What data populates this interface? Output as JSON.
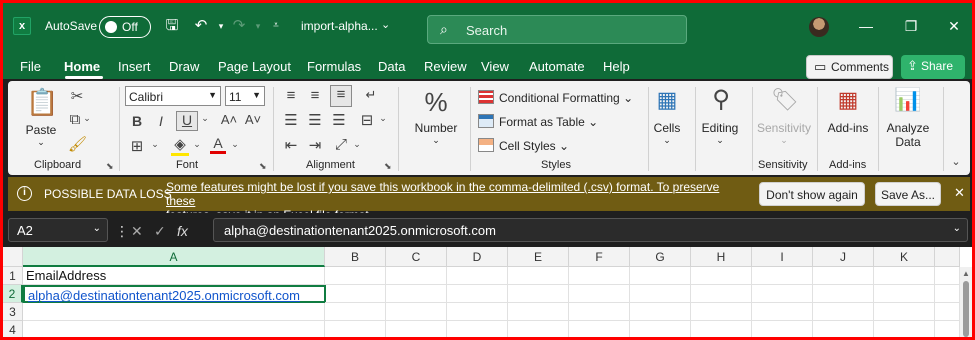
{
  "titlebar": {
    "autosave_label": "AutoSave",
    "autosave_state": "Off",
    "file_name": "import-alpha...",
    "search_placeholder": "Search"
  },
  "menu": [
    "File",
    "Home",
    "Insert",
    "Draw",
    "Page Layout",
    "Formulas",
    "Data",
    "Review",
    "View",
    "Automate",
    "Help"
  ],
  "active_menu": "Home",
  "comments_label": "Comments",
  "share_label": "Share",
  "ribbon": {
    "clipboard": {
      "paste": "Paste",
      "label": "Clipboard"
    },
    "font": {
      "name": "Calibri",
      "size": "11",
      "label": "Font"
    },
    "alignment": {
      "label": "Alignment"
    },
    "number": {
      "label": "Number"
    },
    "styles": {
      "conditional": "Conditional Formatting",
      "format_table": "Format as Table",
      "cell_styles": "Cell Styles",
      "label": "Styles"
    },
    "cells": {
      "label": "Cells"
    },
    "editing": {
      "label": "Editing"
    },
    "sensitivity": {
      "button": "Sensitivity",
      "label": "Sensitivity"
    },
    "addins": {
      "button": "Add-ins",
      "label": "Add-ins"
    },
    "analyze": {
      "line1": "Analyze",
      "line2": "Data"
    }
  },
  "message_bar": {
    "title": "POSSIBLE DATA LOSS",
    "line1": "Some features might be lost if you save this workbook in the comma-delimited (.csv) format. To preserve these",
    "line2": "features, save it in an Excel file format.",
    "dont_show": "Don't show again",
    "save_as": "Save As..."
  },
  "formula_bar": {
    "name_box": "A2",
    "formula": "alpha@destinationtenant2025.onmicrosoft.com"
  },
  "sheet": {
    "columns": [
      "A",
      "B",
      "C",
      "D",
      "E",
      "F",
      "G",
      "H",
      "I",
      "J",
      "K"
    ],
    "rows": [
      "1",
      "2",
      "3",
      "4"
    ],
    "cells": {
      "A1": "EmailAddress",
      "A2": "alpha@destinationtenant2025.onmicrosoft.com"
    }
  },
  "colors": {
    "title_green": "#0f6b38",
    "message_bar": "#705c13",
    "accent": "#107c41"
  }
}
